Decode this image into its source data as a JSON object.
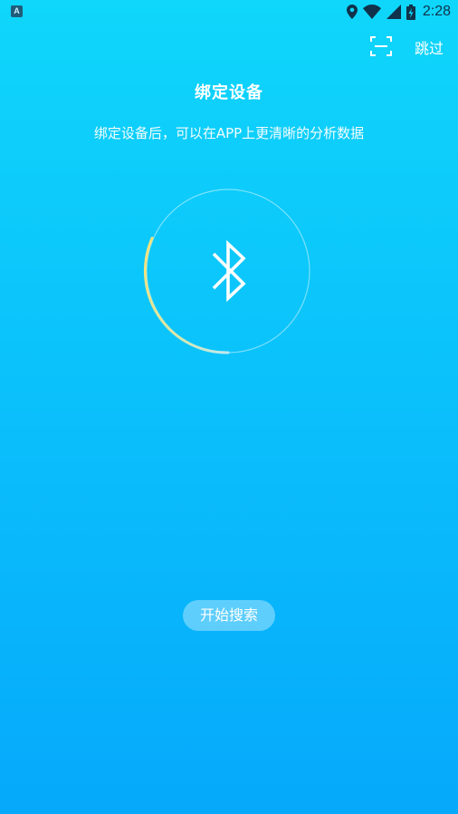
{
  "status_bar": {
    "notification_icon": "A",
    "time": "2:28",
    "icons": [
      "location-icon",
      "wifi-icon",
      "signal-icon",
      "battery-charging-icon"
    ]
  },
  "header": {
    "scan_icon": "scan-icon",
    "skip_label": "跳过"
  },
  "main": {
    "title": "绑定设备",
    "subtitle": "绑定设备后，可以在APP上更清晰的分析数据",
    "center_icon": "bluetooth-icon",
    "search_button_label": "开始搜索"
  },
  "colors": {
    "background_top": "#0fd6fb",
    "background_bottom": "#06a9fb",
    "ring_progress": "#f6e27a"
  }
}
